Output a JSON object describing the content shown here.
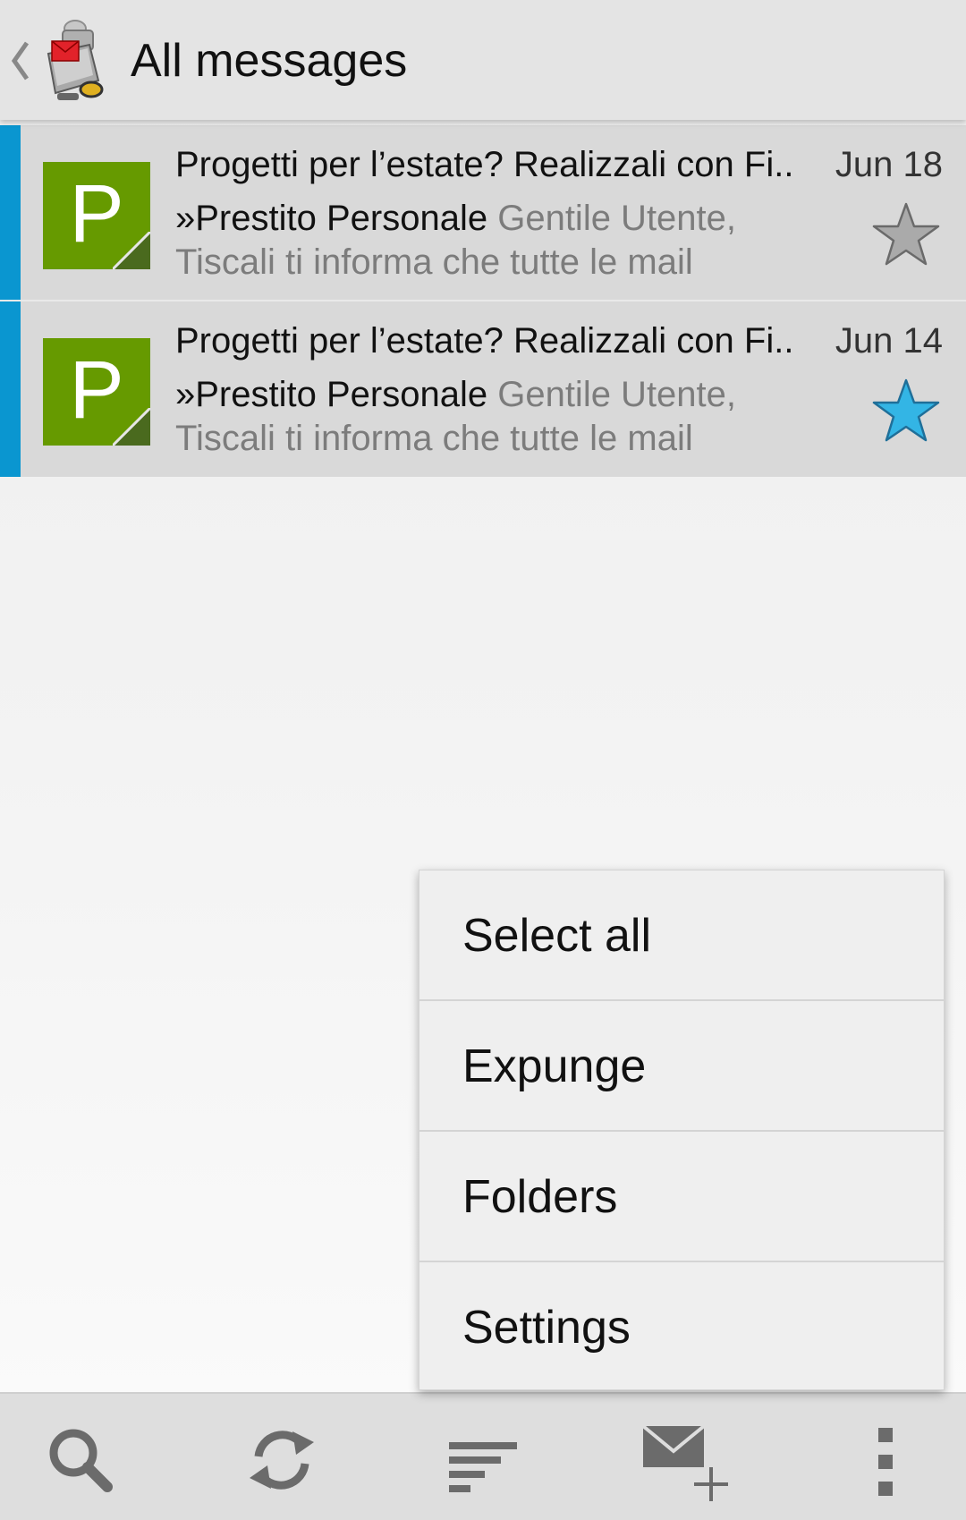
{
  "appbar": {
    "title": "All messages",
    "back_icon": "chevron-left-icon",
    "logo_icon": "k9-mail-dog-logo-icon"
  },
  "messages": [
    {
      "subject": "Progetti per l’estate? Realizzali con Fi..",
      "date": "Jun 18",
      "sender": "»Prestito Personale",
      "preview": " Gentile Utente, Tiscali ti informa che tutte le mail",
      "avatar_letter": "P",
      "starred": false,
      "unread": true
    },
    {
      "subject": "Progetti per l’estate? Realizzali con Fi..",
      "date": "Jun 14",
      "sender": "»Prestito Personale",
      "preview": " Gentile Utente, Tiscali ti informa che tutte le mail",
      "avatar_letter": "P",
      "starred": true,
      "unread": true
    }
  ],
  "overflow_menu": {
    "items": [
      {
        "label": "Select all"
      },
      {
        "label": "Expunge"
      },
      {
        "label": "Folders"
      },
      {
        "label": "Settings"
      }
    ]
  },
  "bottom_bar": {
    "actions": [
      {
        "icon": "search-icon"
      },
      {
        "icon": "refresh-icon"
      },
      {
        "icon": "sort-icon"
      },
      {
        "icon": "compose-icon"
      },
      {
        "icon": "more-vert-icon"
      }
    ]
  },
  "colors": {
    "accent": "#0a96d0",
    "avatar_bg": "#669a00",
    "avatar_corner": "#4a6a1e",
    "star_on": "#33b5e5",
    "star_off": "#aaaaaa",
    "appbar_bg": "#e4e4e4",
    "row_bg": "#d9d9d9"
  }
}
